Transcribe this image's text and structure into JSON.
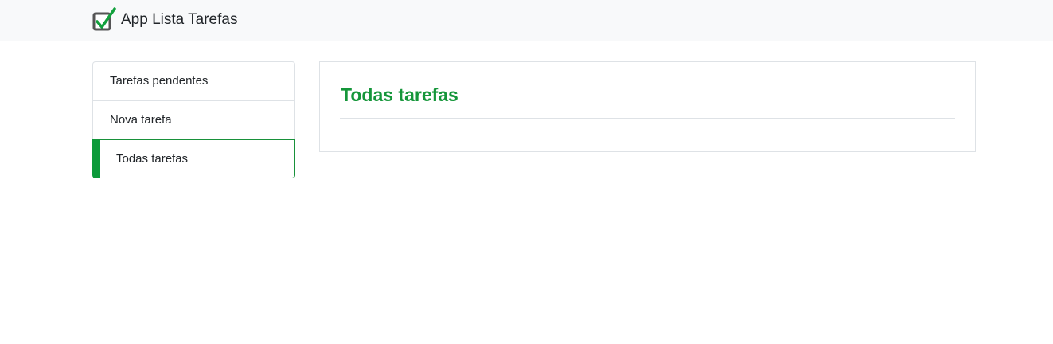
{
  "navbar": {
    "brand_label": "App Lista Tarefas",
    "brand_icon": "checkbox-checked-icon"
  },
  "sidebar": {
    "items": [
      {
        "label": "Tarefas pendentes",
        "active": false
      },
      {
        "label": "Nova tarefa",
        "active": false
      },
      {
        "label": "Todas tarefas",
        "active": true
      }
    ]
  },
  "main": {
    "title": "Todas tarefas"
  },
  "colors": {
    "accent": "#0c9a3a",
    "navbar_bg": "#f8f9fa",
    "border": "#dee2e6"
  }
}
